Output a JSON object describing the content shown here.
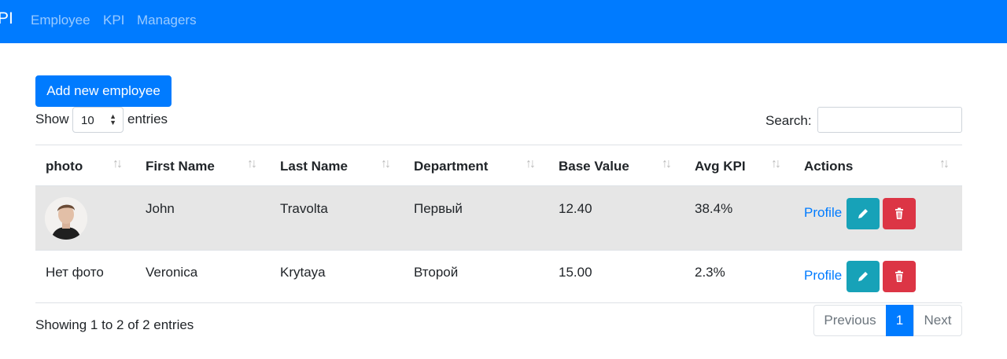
{
  "navbar": {
    "brand": "PI",
    "links": [
      "Employee",
      "KPI",
      "Managers"
    ],
    "color": "#007bff"
  },
  "toolbar": {
    "add_label": "Add new employee",
    "show_label": "Show",
    "page_size": "10",
    "entries_label": "entries",
    "search_label": "Search:",
    "search_value": ""
  },
  "table": {
    "headers": [
      "photo",
      "First Name",
      "Last Name",
      "Department",
      "Base Value",
      "Avg KPI",
      "Actions"
    ],
    "rows": [
      {
        "photo": "",
        "first_name": "John",
        "last_name": "Travolta",
        "department": "Первый",
        "base_value": "12.40",
        "avg_kpi": "38.4%",
        "profile": "Profile"
      },
      {
        "photo": "Нет фото",
        "first_name": "Veronica",
        "last_name": "Krytaya",
        "department": "Второй",
        "base_value": "15.00",
        "avg_kpi": "2.3%",
        "profile": "Profile"
      }
    ]
  },
  "footer": {
    "info": "Showing 1 to 2 of 2 entries",
    "prev": "Previous",
    "page": "1",
    "next": "Next"
  },
  "icons": {
    "sort": "sort-arrows-icon",
    "edit": "pencil-icon",
    "delete": "trash-icon"
  },
  "colors": {
    "primary": "#007bff",
    "info": "#17a2b8",
    "danger": "#dc3545"
  }
}
